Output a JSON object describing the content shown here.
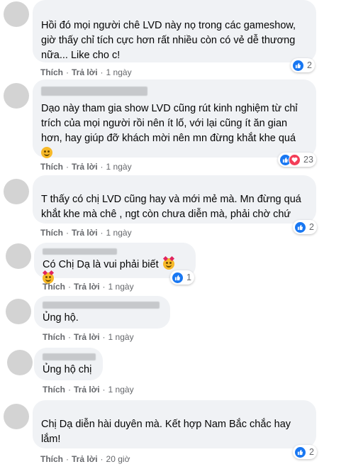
{
  "actions": {
    "like": "Thích",
    "reply": "Trả lời",
    "separator": "·"
  },
  "comments": [
    {
      "text": "Hồi đó mọi người chê LVD này nọ trong các gameshow, giờ thấy chỉ tích cực hơn rất nhiều còn có vẻ dễ thương nữa... Like cho c!",
      "time": "1 ngày",
      "reaction_count": "2",
      "reactions": [
        "like-icon"
      ]
    },
    {
      "text": "Dạo này tham gia show LVD cũng rút kinh nghiệm từ chỉ trích của mọi người rồi nên ít lố, với lại cũng ít ăn gian hơn, hay giúp đỡ khách mời nên mn đừng khắt khe quá",
      "time": "1 ngày",
      "reaction_count": "23",
      "reactions": [
        "like-icon",
        "love-icon"
      ]
    },
    {
      "text": "T thấy có chị LVD cũng hay và mới mẻ mà. Mn đừng quá khắt khe mà chê , ngt còn chưa diễn mà, phải chờ chứ",
      "time": "1 ngày",
      "reaction_count": "2",
      "reactions": [
        "like-icon"
      ]
    },
    {
      "text": "Có Chị Dạ là vui phải biết",
      "time": "1 ngày",
      "reaction_count": "1",
      "reactions": [
        "like-icon"
      ]
    },
    {
      "text": "Ủng hộ.",
      "time": "1 ngày",
      "reaction_count": "",
      "reactions": []
    },
    {
      "text": "Ủng hộ chị",
      "time": "1 ngày",
      "reaction_count": "",
      "reactions": []
    },
    {
      "text": "Chị Dạ diễn hài duyên mà. Kết hợp Nam Bắc chắc hay lắm!",
      "time": "20 giờ",
      "reaction_count": "2",
      "reactions": [
        "like-icon"
      ]
    }
  ],
  "colors": {
    "like": "#1877f2",
    "love": "#f33e58",
    "bubble": "#f0f2f5",
    "meta": "#65676b"
  }
}
